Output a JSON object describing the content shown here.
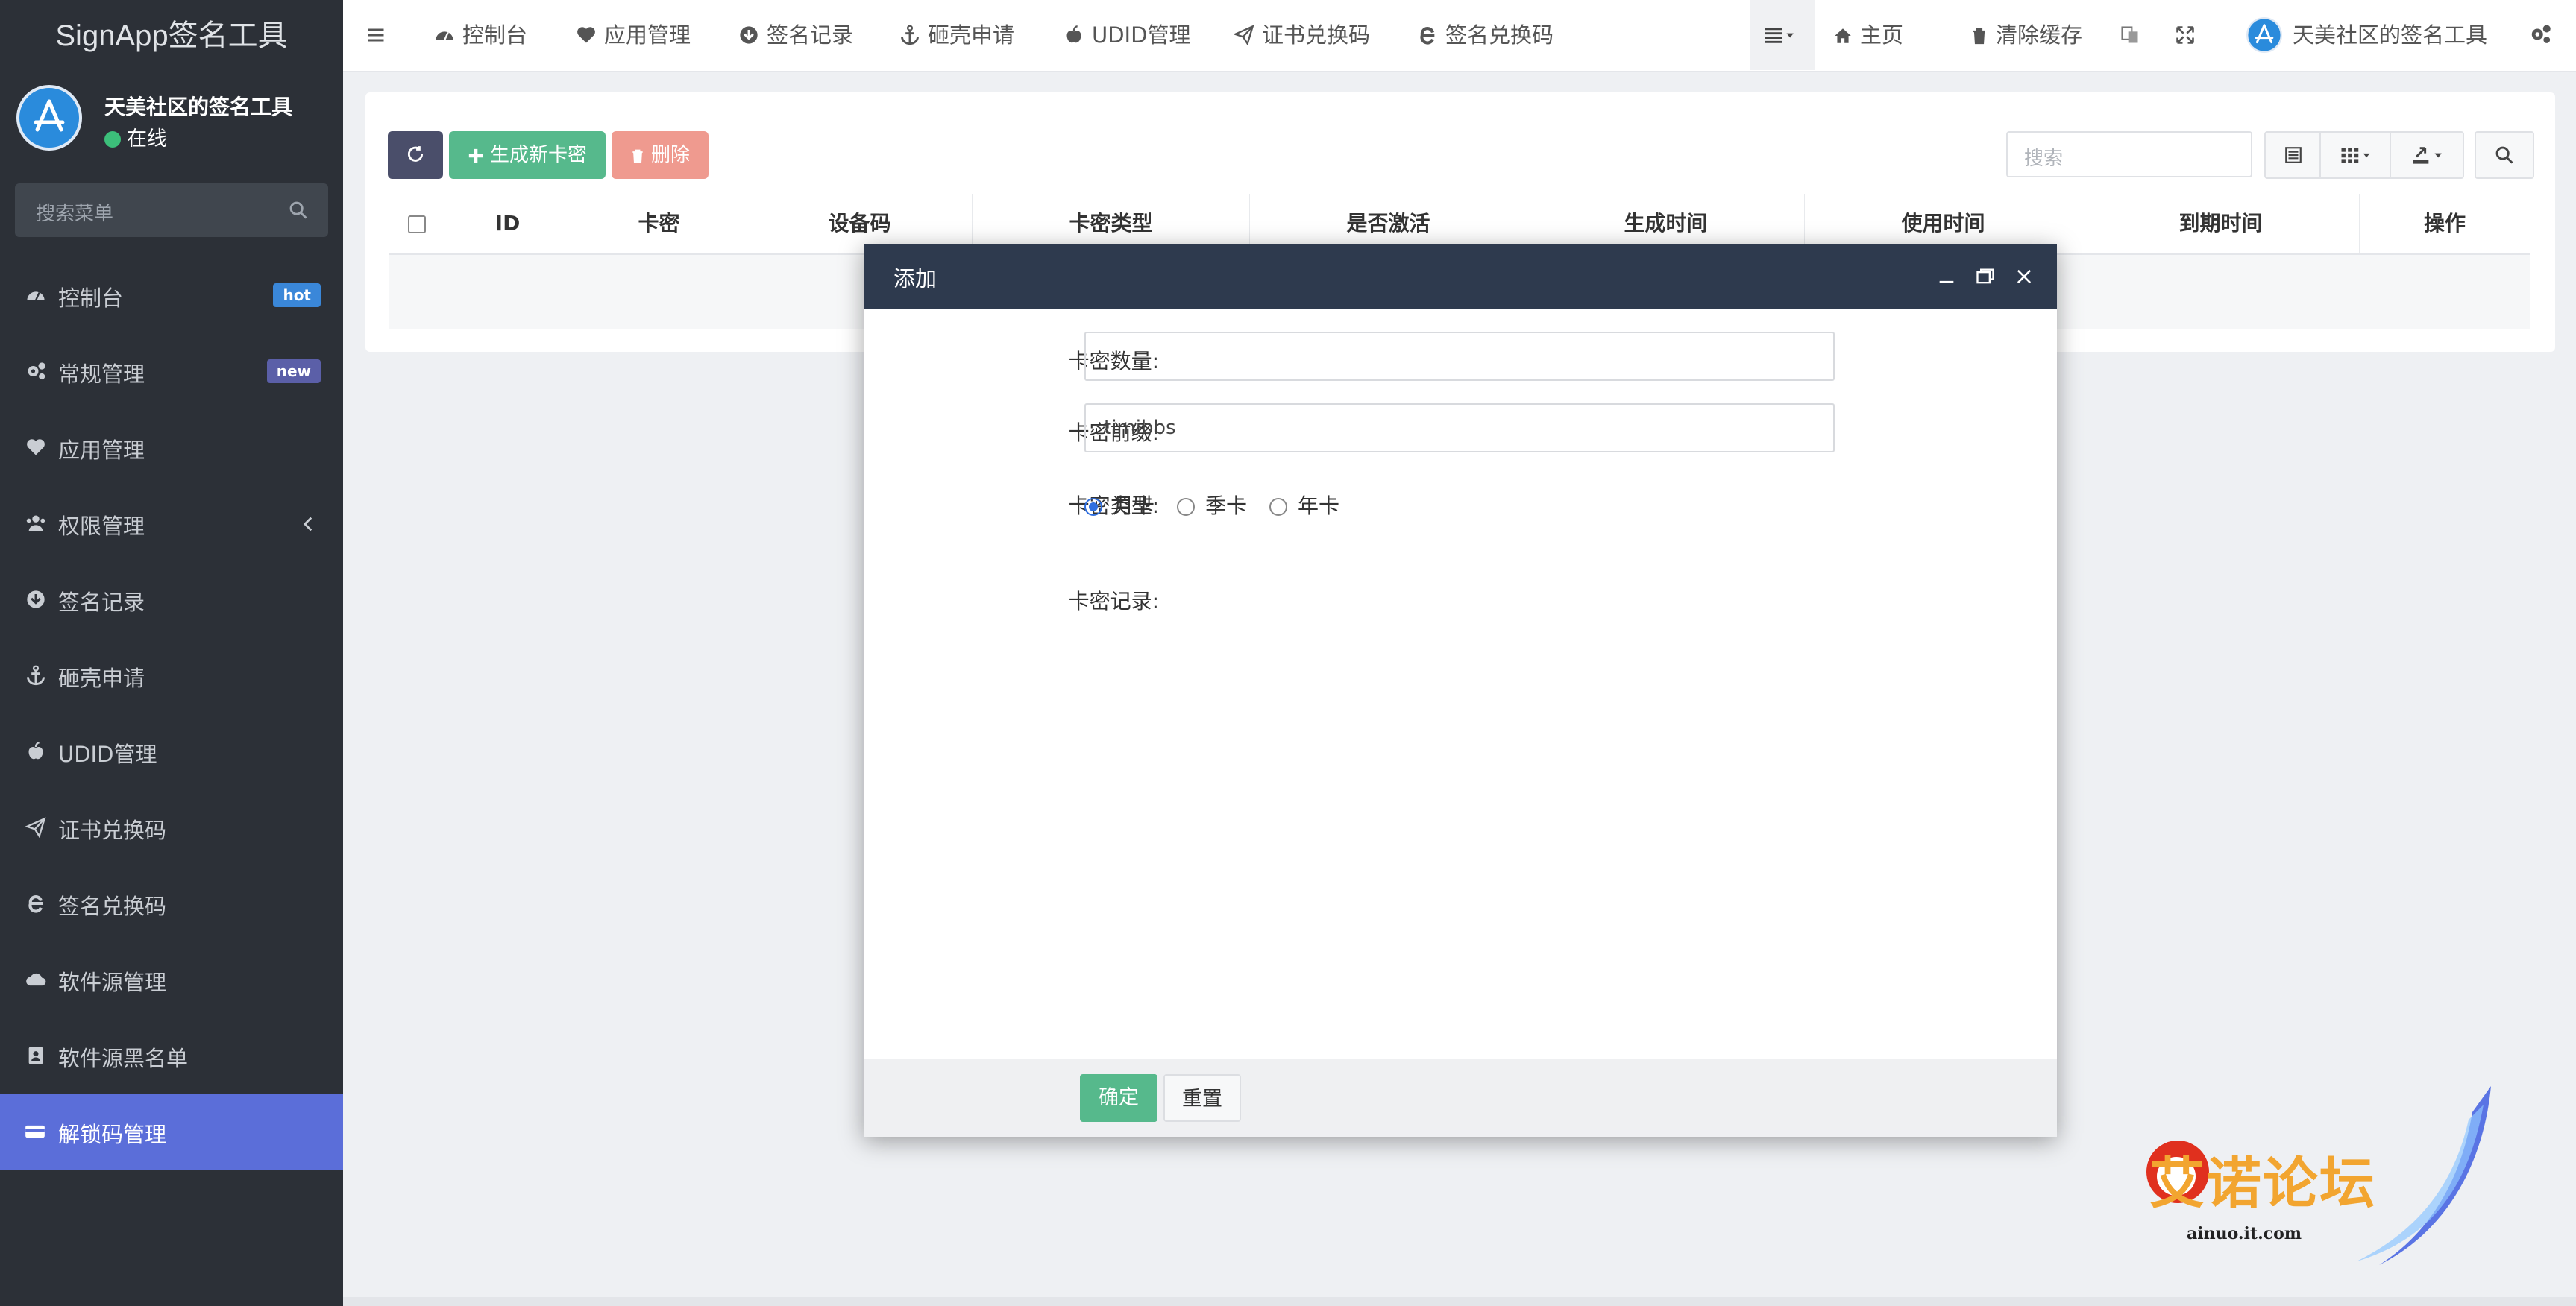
{
  "app": {
    "title": "SignApp签名工具"
  },
  "user": {
    "name": "天美社区的签名工具",
    "status": "在线"
  },
  "sidebar": {
    "search_placeholder": "搜索菜单",
    "items": [
      {
        "label": "控制台",
        "icon": "dashboard-icon",
        "badge": "hot"
      },
      {
        "label": "常规管理",
        "icon": "cogs-icon",
        "badge": "new"
      },
      {
        "label": "应用管理",
        "icon": "heart-icon"
      },
      {
        "label": "权限管理",
        "icon": "users-icon"
      },
      {
        "label": "签名记录",
        "icon": "arrow-circle-down-icon"
      },
      {
        "label": "砸壳申请",
        "icon": "anchor-icon"
      },
      {
        "label": "UDID管理",
        "icon": "apple-icon"
      },
      {
        "label": "证书兑换码",
        "icon": "paper-plane-icon"
      },
      {
        "label": "签名兑换码",
        "icon": "edge-icon"
      },
      {
        "label": "软件源管理",
        "icon": "cloud-icon"
      },
      {
        "label": "软件源黑名单",
        "icon": "address-book-icon"
      },
      {
        "label": "解锁码管理",
        "icon": "credit-card-icon",
        "active": true
      }
    ]
  },
  "topnav": {
    "items": [
      {
        "label": "控制台",
        "icon": "dashboard-icon"
      },
      {
        "label": "应用管理",
        "icon": "heart-icon"
      },
      {
        "label": "签名记录",
        "icon": "arrow-circle-down-icon"
      },
      {
        "label": "砸壳申请",
        "icon": "anchor-icon"
      },
      {
        "label": "UDID管理",
        "icon": "apple-icon"
      },
      {
        "label": "证书兑换码",
        "icon": "paper-plane-icon"
      },
      {
        "label": "签名兑换码",
        "icon": "edge-icon"
      }
    ],
    "right": {
      "home": "主页",
      "clear_cache": "清除缓存",
      "user": "天美社区的签名工具"
    }
  },
  "toolbar": {
    "refresh": "",
    "generate": "生成新卡密",
    "delete": "删除",
    "search_placeholder": "搜索"
  },
  "table": {
    "columns": [
      "ID",
      "卡密",
      "设备码",
      "卡密类型",
      "是否激活",
      "生成时间",
      "使用时间",
      "到期时间",
      "操作"
    ]
  },
  "modal": {
    "title": "添加",
    "fields": {
      "count_label": "卡密数量:",
      "count_value": "",
      "prefix_label": "卡密前缀:",
      "prefix_value": "timibbs",
      "type_label": "卡密类型:",
      "type_options": [
        "月卡",
        "季卡",
        "年卡"
      ],
      "type_selected": "月卡",
      "record_label": "卡密记录:"
    },
    "confirm": "确定",
    "reset": "重置"
  },
  "watermark": {
    "text": "艾诺论坛",
    "url": "ainuo.it.com"
  },
  "colors": {
    "sidebar_bg": "#2c3037",
    "active_menu": "#5b6ed9",
    "modal_header": "#2e3a4e",
    "btn_refresh": "#4a4e6a",
    "btn_generate": "#56b98c",
    "btn_delete": "#ef9a8f",
    "btn_confirm": "#56b98c",
    "badge_hot": "#3a87d9",
    "badge_new": "#5b5fa8"
  }
}
